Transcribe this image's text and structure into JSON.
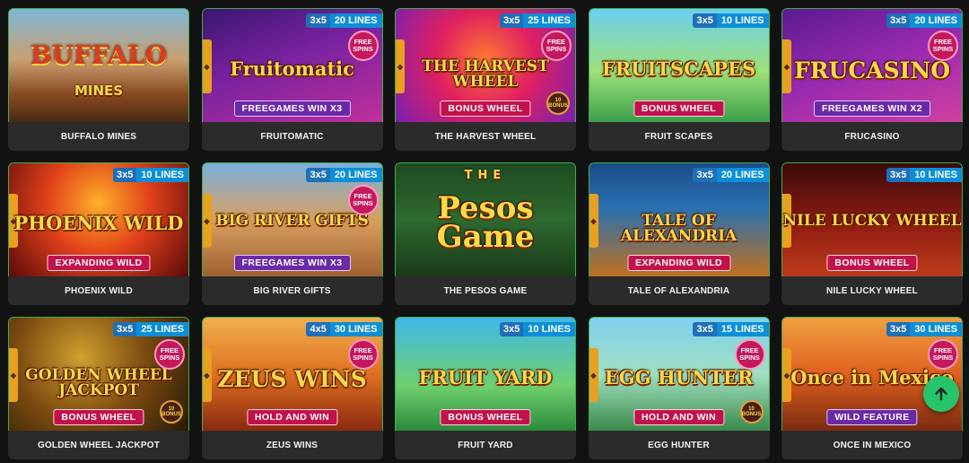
{
  "games": [
    {
      "name": "BUFFALO MINES",
      "art_title": "BUFFALO",
      "art_sub": "MINES",
      "reels": "",
      "lines": "",
      "feature": "",
      "free_spins": "",
      "bonus_badge": "",
      "side_tab": false,
      "bg": "linear-gradient(180deg,#7fb6d8 0%,#c9a070 45%,#8a4a22 75%,#4a2a12 100%)"
    },
    {
      "name": "FRUITOMATIC",
      "art_title": "Fruitomatic",
      "art_sub": "",
      "reels": "3x5",
      "lines": "20 LINES",
      "feature": "FREEGAMES WIN X3",
      "free_spins": "FREE SPINS",
      "bonus_badge": "",
      "side_tab": true,
      "bg": "linear-gradient(160deg,#3a1670 0%,#7a22a0 45%,#c0309a 100%)"
    },
    {
      "name": "THE HARVEST WHEEL",
      "art_title": "THE HARVEST WHEEL",
      "art_sub": "",
      "reels": "3x5",
      "lines": "25 LINES",
      "feature": "BONUS WHEEL",
      "free_spins": "FREE SPINS",
      "bonus_badge": "10 BONUS",
      "side_tab": true,
      "bg": "radial-gradient(circle at 50% 45%,#ff7a30 0%,#e02060 45%,#7a1fb0 100%)"
    },
    {
      "name": "FRUIT SCAPES",
      "art_title": "FRUITSCAPES",
      "art_sub": "",
      "reels": "3x5",
      "lines": "10 LINES",
      "feature": "BONUS WHEEL",
      "free_spins": "",
      "bonus_badge": "",
      "side_tab": false,
      "bg": "linear-gradient(180deg,#6ad0f0 0%,#9fe07a 55%,#3aa04a 100%)"
    },
    {
      "name": "FRUCASINO",
      "art_title": "FRUCASINO",
      "art_sub": "",
      "reels": "3x5",
      "lines": "20 LINES",
      "feature": "FREEGAMES WIN X2",
      "free_spins": "FREE SPINS",
      "bonus_badge": "",
      "side_tab": true,
      "bg": "linear-gradient(160deg,#5a1a90 0%,#9a2ab0 50%,#d040a0 100%)"
    },
    {
      "name": "PHOENIX WILD",
      "art_title": "PHOENIX WILD",
      "art_sub": "",
      "reels": "3x5",
      "lines": "10 LINES",
      "feature": "EXPANDING WILD",
      "free_spins": "",
      "bonus_badge": "",
      "side_tab": true,
      "bg": "radial-gradient(circle at 50% 35%,#ffb02a 0%,#e0401a 45%,#5a0a0a 100%)"
    },
    {
      "name": "BIG RIVER GIFTS",
      "art_title": "BIG RIVER GIFTS",
      "art_sub": "",
      "reels": "3x5",
      "lines": "20 LINES",
      "feature": "FREEGAMES WIN X3",
      "free_spins": "FREE SPINS",
      "bonus_badge": "",
      "side_tab": true,
      "bg": "linear-gradient(180deg,#7ab0e0 0%,#d8a060 50%,#a06030 100%)"
    },
    {
      "name": "THE PESOS GAME",
      "art_title": "Pesos Game",
      "art_sub": "THE",
      "reels": "",
      "lines": "",
      "feature": "",
      "free_spins": "",
      "bonus_badge": "",
      "side_tab": false,
      "bg": "linear-gradient(180deg,#1e4a22 0%,#2e6a30 50%,#1a3a18 100%)"
    },
    {
      "name": "TALE OF ALEXANDRIA",
      "art_title": "TALE OF ALEXANDRIA",
      "art_sub": "",
      "reels": "3x5",
      "lines": "20 LINES",
      "feature": "EXPANDING WILD",
      "free_spins": "",
      "bonus_badge": "",
      "side_tab": true,
      "bg": "linear-gradient(180deg,#1a4a8a 0%,#2a70b0 40%,#c07020 100%)"
    },
    {
      "name": "NILE LUCKY WHEEL",
      "art_title": "NILE LUCKY WHEEL",
      "art_sub": "",
      "reels": "3x5",
      "lines": "10 LINES",
      "feature": "BONUS WHEEL",
      "free_spins": "",
      "bonus_badge": "",
      "side_tab": true,
      "bg": "linear-gradient(180deg,#3a0a0a 0%,#8a1a12 50%,#c03a1a 100%)"
    },
    {
      "name": "GOLDEN WHEEL JACKPOT",
      "art_title": "GOLDEN WHEEL JACKPOT",
      "art_sub": "",
      "reels": "3x5",
      "lines": "25 LINES",
      "feature": "BONUS WHEEL",
      "free_spins": "FREE SPINS",
      "bonus_badge": "10 BONUS",
      "side_tab": true,
      "bg": "radial-gradient(circle at 40% 35%,#d0a030 0%,#7a4a10 50%,#2a1a08 100%)"
    },
    {
      "name": "ZEUS WINS",
      "art_title": "ZEUS WINS",
      "art_sub": "",
      "reels": "4x5",
      "lines": "30 LINES",
      "feature": "HOLD AND WIN",
      "free_spins": "FREE SPINS",
      "bonus_badge": "",
      "side_tab": true,
      "bg": "linear-gradient(180deg,#f0b050 0%,#e07020 50%,#8a2a10 100%)"
    },
    {
      "name": "FRUIT YARD",
      "art_title": "FRUIT YARD",
      "art_sub": "",
      "reels": "3x5",
      "lines": "10 LINES",
      "feature": "BONUS WHEEL",
      "free_spins": "",
      "bonus_badge": "",
      "side_tab": false,
      "bg": "linear-gradient(180deg,#40b8e8 0%,#70d070 60%,#2a8a3a 100%)"
    },
    {
      "name": "EGG HUNTER",
      "art_title": "EGG HUNTER",
      "art_sub": "",
      "reels": "3x5",
      "lines": "15 LINES",
      "feature": "HOLD AND WIN",
      "free_spins": "FREE SPINS",
      "bonus_badge": "10 BONUS",
      "side_tab": true,
      "bg": "linear-gradient(180deg,#7fd0f0 0%,#a0e0c0 50%,#3a8a4a 100%)"
    },
    {
      "name": "ONCE IN MEXICO",
      "art_title": "Once in Mexico",
      "art_sub": "",
      "reels": "3x5",
      "lines": "30 LINES",
      "feature": "WILD FEATURE",
      "free_spins": "FREE SPINS",
      "bonus_badge": "",
      "side_tab": true,
      "bg": "linear-gradient(180deg,#f0a040 0%,#e06020 50%,#7a2a10 100%)"
    }
  ],
  "scroll_top": {
    "icon": "arrow-up-icon",
    "color": "#27c46b"
  }
}
